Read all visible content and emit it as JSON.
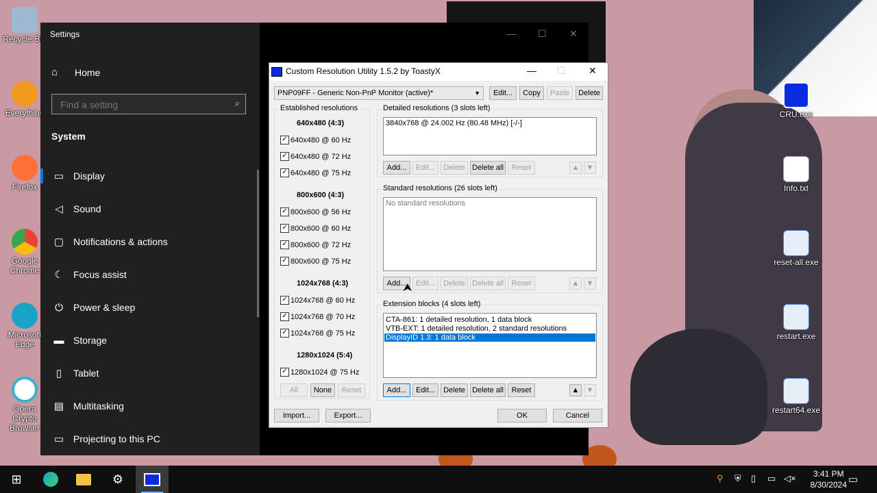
{
  "desktop": {
    "left_icons": [
      {
        "label": "Recycle Bin",
        "color": "#9fb7d1"
      },
      {
        "label": "Everything",
        "color": "#f29a1e"
      },
      {
        "label": "Firefox",
        "color": "#ff7139"
      },
      {
        "label": "Google Chrome",
        "color": "#4caf50"
      },
      {
        "label": "Microsoft Edge",
        "color": "#1aa3c9"
      },
      {
        "label": "Opera Crypto Browser",
        "color": "#35b3c9"
      }
    ],
    "right_icons": [
      {
        "label": "CRU.exe"
      },
      {
        "label": "Info.txt"
      },
      {
        "label": "reset-all.exe"
      },
      {
        "label": "restart.exe"
      },
      {
        "label": "restart64.exe"
      }
    ]
  },
  "settings": {
    "title": "Settings",
    "home_label": "Home",
    "search_placeholder": "Find a setting",
    "section": "System",
    "nav": [
      {
        "label": "Display",
        "icon": "monitor-icon",
        "glyph": "▭"
      },
      {
        "label": "Sound",
        "icon": "speaker-icon",
        "glyph": "◁"
      },
      {
        "label": "Notifications & actions",
        "icon": "notifications-icon",
        "glyph": "▢"
      },
      {
        "label": "Focus assist",
        "icon": "moon-icon",
        "glyph": "☾"
      },
      {
        "label": "Power & sleep",
        "icon": "power-icon",
        "glyph": "⏻"
      },
      {
        "label": "Storage",
        "icon": "storage-icon",
        "glyph": "▬"
      },
      {
        "label": "Tablet",
        "icon": "tablet-icon",
        "glyph": "▯"
      },
      {
        "label": "Multitasking",
        "icon": "multitasking-icon",
        "glyph": "▤"
      },
      {
        "label": "Projecting to this PC",
        "icon": "projecting-icon",
        "glyph": "▭"
      }
    ]
  },
  "cru": {
    "title": "Custom Resolution Utility 1.5.2 by ToastyX",
    "monitor": "PNP09FF - Generic Non-PnP Monitor (active)*",
    "top_buttons": {
      "edit": "Edit...",
      "copy": "Copy",
      "paste": "Paste",
      "delete": "Delete"
    },
    "established": {
      "label": "Established resolutions",
      "groups": [
        {
          "title": "640x480 (4:3)",
          "items": [
            "640x480 @ 60 Hz",
            "640x480 @ 72 Hz",
            "640x480 @ 75 Hz"
          ]
        },
        {
          "title": "800x600 (4:3)",
          "items": [
            "800x600 @ 56 Hz",
            "800x600 @ 60 Hz",
            "800x600 @ 72 Hz",
            "800x600 @ 75 Hz"
          ]
        },
        {
          "title": "1024x768 (4:3)",
          "items": [
            "1024x768 @ 60 Hz",
            "1024x768 @ 70 Hz",
            "1024x768 @ 75 Hz"
          ]
        },
        {
          "title": "1280x1024 (5:4)",
          "items": [
            "1280x1024 @ 75 Hz"
          ]
        }
      ],
      "buttons": {
        "all": "All",
        "none": "None",
        "reset": "Reset"
      }
    },
    "detailed": {
      "label": "Detailed resolutions (3 slots left)",
      "rows": [
        "3840x768 @ 24.002 Hz (80.48 MHz) [-/-]"
      ]
    },
    "standard": {
      "label": "Standard resolutions (26 slots left)",
      "empty": "No standard resolutions"
    },
    "extension": {
      "label": "Extension blocks (4 slots left)",
      "rows": [
        "CTA-861: 1 detailed resolution, 1 data block",
        "VTB-EXT: 1 detailed resolution, 2 standard resolutions",
        "DisplayID 1.3: 1 data block"
      ]
    },
    "list_buttons": {
      "add": "Add...",
      "edit": "Edit...",
      "delete": "Delete",
      "delete_all": "Delete all",
      "reset": "Reset"
    },
    "bottom": {
      "import": "Import...",
      "export": "Export...",
      "ok": "OK",
      "cancel": "Cancel"
    }
  },
  "taskbar": {
    "time": "3:41 PM",
    "date": "8/30/2024",
    "accent": "#76b9ed"
  }
}
